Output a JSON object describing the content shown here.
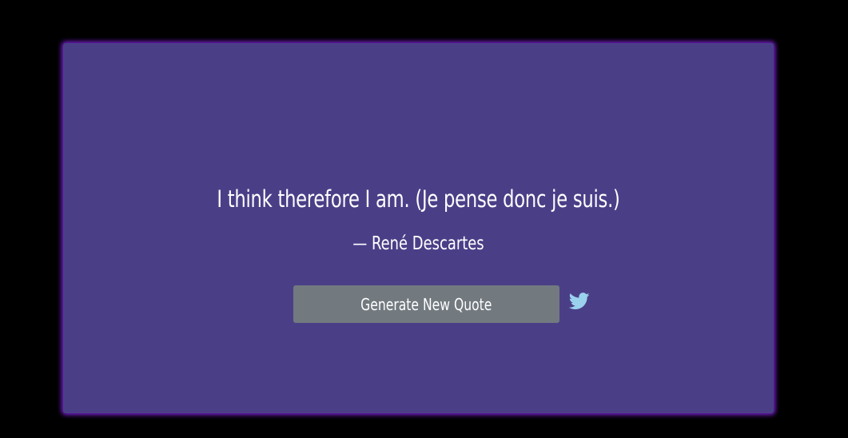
{
  "quote": {
    "text": "I think therefore I am. (Je pense donc je suis.)",
    "author": "— René Descartes"
  },
  "actions": {
    "new_quote_label": "Generate New Quote",
    "tweet_icon": "twitter-icon"
  },
  "colors": {
    "page_background": "#000000",
    "card_background": "#4a3f87",
    "card_glow": "#7d1fd6",
    "button_background": "#727a80",
    "twitter_blue": "#9ad2ee",
    "text": "#ffffff"
  }
}
